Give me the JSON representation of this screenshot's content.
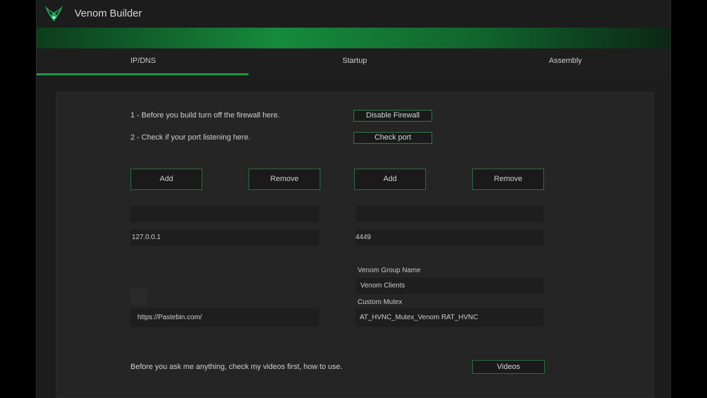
{
  "app": {
    "title": "Venom Builder",
    "logo_icon": "venom-logo-icon"
  },
  "colors": {
    "accent": "#1e9a45",
    "background": "#1d1d1d",
    "panel": "#252525"
  },
  "tabs": [
    {
      "label": "IP/DNS",
      "selected": true
    },
    {
      "label": "Startup",
      "selected": false
    },
    {
      "label": "Assembly",
      "selected": false
    }
  ],
  "steps": {
    "firewall_text": "1 - Before you build turn off the firewall here.",
    "firewall_button": "Disable Firewall",
    "port_text": "2 - Check if your port listening here.",
    "port_button": "Check port"
  },
  "hosts": {
    "add_label": "Add",
    "remove_label": "Remove",
    "input_value": "",
    "list_items": [
      "127.0.0.1"
    ]
  },
  "ports": {
    "add_label": "Add",
    "remove_label": "Remove",
    "input_value": "",
    "list_items": [
      "4449"
    ]
  },
  "pastebin": {
    "value": "https://Pastebin.com/"
  },
  "group": {
    "label": "Venom Group Name",
    "value": "Venom Clients"
  },
  "mutex": {
    "label": "Custom Mutex",
    "value": "AT_HVNC_Mutex_Venom RAT_HVNC"
  },
  "footer": {
    "text": "Before you ask me anything, check my videos first, how to use.",
    "videos_button": "Videos"
  }
}
